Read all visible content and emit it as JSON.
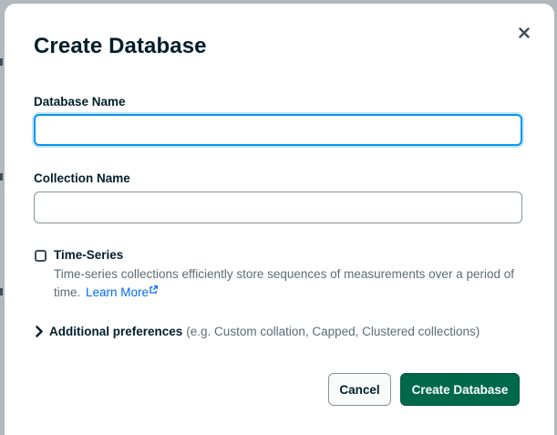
{
  "modal": {
    "title": "Create Database",
    "close_icon": "close-icon"
  },
  "database_name": {
    "label": "Database Name",
    "value": "",
    "placeholder": ""
  },
  "collection_name": {
    "label": "Collection Name",
    "value": "",
    "placeholder": ""
  },
  "time_series": {
    "label": "Time-Series",
    "checked": false,
    "description": "Time-series collections efficiently store sequences of measurements over a period of time.",
    "learn_more": "Learn More",
    "link_icon": "external-link-icon"
  },
  "additional_preferences": {
    "icon": "chevron-right-icon",
    "label": "Additional preferences",
    "hint": "(e.g. Custom collation, Capped, Clustered collections)"
  },
  "footer": {
    "cancel_label": "Cancel",
    "create_label": "Create Database"
  },
  "colors": {
    "primary": "#00684a",
    "focus": "#0498ec",
    "link": "#016bf8",
    "text": "#001e2b",
    "muted_text": "#5c6c75"
  }
}
